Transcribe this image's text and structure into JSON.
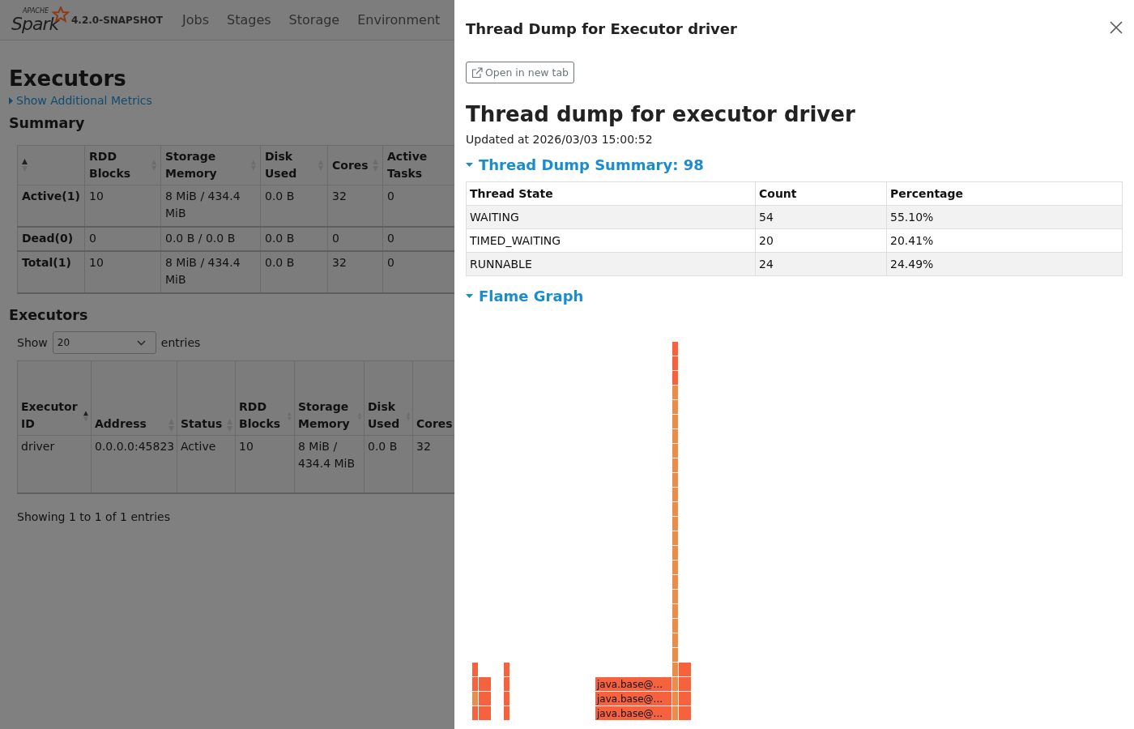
{
  "navbar": {
    "logo_small": "APACHE",
    "logo": "Spark",
    "version": "4.2.0-SNAPSHOT",
    "items": [
      {
        "label": "Jobs"
      },
      {
        "label": "Stages"
      },
      {
        "label": "Storage"
      },
      {
        "label": "Environment"
      }
    ]
  },
  "page": {
    "title": "Executors",
    "toggle": "Show Additional Metrics",
    "summary_heading": "Summary",
    "summary_table": {
      "columns": [
        {
          "sorted": true
        },
        {
          "label": "RDD Blocks",
          "sorted": false
        },
        {
          "label": "Storage Memory",
          "sorted": false
        },
        {
          "label": "Disk Used",
          "sorted": false
        },
        {
          "label": "Cores",
          "sorted": false
        },
        {
          "label": "Active Tasks"
        }
      ],
      "rows": [
        [
          "Active(1)",
          "10",
          "8 MiB / 434.4 MiB",
          "0.0 B",
          "32",
          "0"
        ],
        [
          "Dead(0)",
          "0",
          "0.0 B / 0.0 B",
          "0.0 B",
          "0",
          "0"
        ],
        [
          "Total(1)",
          "10",
          "8 MiB / 434.4 MiB",
          "0.0 B",
          "32",
          "0"
        ]
      ]
    },
    "executors_heading": "Executors",
    "show_label": "Show",
    "page_size": "20",
    "entries_label": "entries",
    "executors_table": {
      "columns": [
        {
          "label": "Executor ID",
          "sorted": true
        },
        {
          "label": "Address",
          "sorted": false
        },
        {
          "label": "Status",
          "sorted": false
        },
        {
          "label": "RDD Blocks",
          "sorted": false
        },
        {
          "label": "Storage Memory",
          "sorted": false
        },
        {
          "label": "Disk Used",
          "sorted": false
        },
        {
          "label": "Cores"
        }
      ],
      "rows": [
        [
          "driver",
          "0.0.0.0:45823",
          "Active",
          "10",
          "8 MiB / 434.4 MiB",
          "0.0 B",
          "32"
        ]
      ]
    },
    "footer": "Showing 1 to 1 of 1 entries"
  },
  "drawer": {
    "title": "Thread Dump for Executor driver",
    "open_button": "Open in new tab",
    "heading": "Thread dump for executor driver",
    "updated": "Updated at 2026/03/03 15:00:52",
    "summary": {
      "label": "Thread Dump Summary: 98",
      "expanded": true,
      "columns": [
        "Thread State",
        "Count",
        "Percentage"
      ],
      "rows": [
        [
          "WAITING",
          "54",
          "55.10%"
        ],
        [
          "TIMED_WAITING",
          "20",
          "20.41%"
        ],
        [
          "RUNNABLE",
          "24",
          "24.49%"
        ]
      ]
    },
    "flame": {
      "label": "Flame Graph",
      "expanded": true,
      "frames": [
        "java.base@...",
        "java.base@...",
        "java.base@..."
      ]
    }
  }
}
